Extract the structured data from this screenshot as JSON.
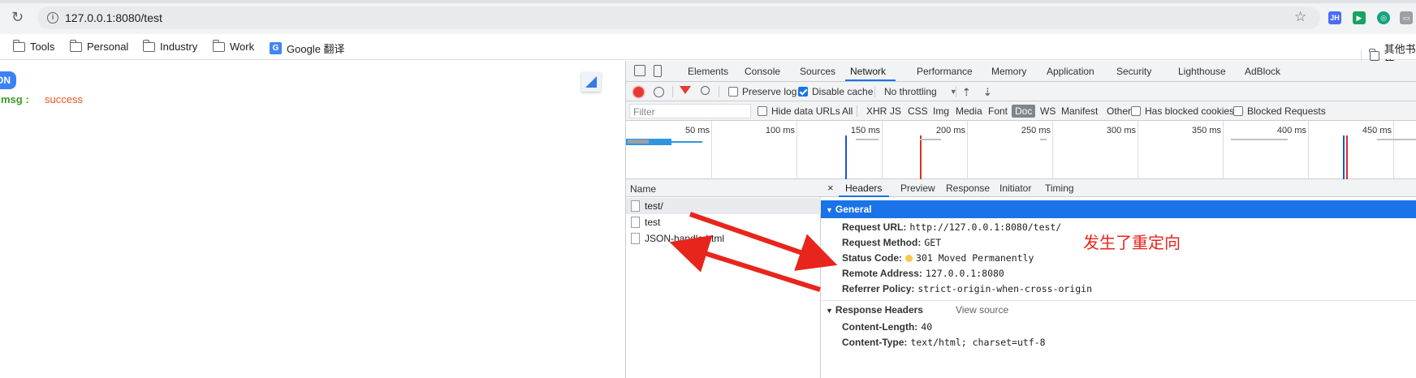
{
  "browser": {
    "url": "127.0.0.1:8080/test",
    "bookmarks": [
      "Tools",
      "Personal",
      "Industry",
      "Work",
      "Google 翻译"
    ],
    "other_bookmarks": "其他书签",
    "extensions": [
      {
        "name": "jh-extension-icon",
        "label": "JH",
        "color": "#4a6cf7"
      },
      {
        "name": "flag-extension-icon",
        "label": "▶",
        "color": "#1aa260"
      },
      {
        "name": "chatgpt-extension-icon",
        "label": "◎",
        "color": "#10a37f"
      },
      {
        "name": "cast-extension-icon",
        "label": "▭",
        "color": "#9aa0a6"
      }
    ]
  },
  "page": {
    "json_label": "ON",
    "msg_key": "msg :",
    "msg_value": "success"
  },
  "devtools": {
    "tabs": [
      "Elements",
      "Console",
      "Sources",
      "Network",
      "Performance",
      "Memory",
      "Application",
      "Security",
      "Lighthouse",
      "AdBlock"
    ],
    "active_tab": "Network",
    "toolbar": {
      "preserve_log": "Preserve log",
      "disable_cache": "Disable cache",
      "throttling": "No throttling"
    },
    "filter": {
      "placeholder": "Filter",
      "hide_data_urls": "Hide data URLs",
      "types": [
        "All",
        "XHR",
        "JS",
        "CSS",
        "Img",
        "Media",
        "Font",
        "Doc",
        "WS",
        "Manifest",
        "Other"
      ],
      "active_type": "Doc",
      "has_blocked_cookies": "Has blocked cookies",
      "blocked_requests": "Blocked Requests"
    },
    "overview_ticks": [
      "50 ms",
      "100 ms",
      "150 ms",
      "200 ms",
      "250 ms",
      "300 ms",
      "350 ms",
      "400 ms",
      "450 ms"
    ],
    "name_header": "Name",
    "requests": [
      "test/",
      "test",
      "JSON-handle.html"
    ],
    "detail_tabs": [
      "Headers",
      "Preview",
      "Response",
      "Initiator",
      "Timing"
    ],
    "general": {
      "title": "General",
      "rows": [
        {
          "k": "Request URL:",
          "v": "http://127.0.0.1:8080/test/"
        },
        {
          "k": "Request Method:",
          "v": "GET"
        },
        {
          "k": "Status Code:",
          "v": "301 Moved Permanently"
        },
        {
          "k": "Remote Address:",
          "v": "127.0.0.1:8080"
        },
        {
          "k": "Referrer Policy:",
          "v": "strict-origin-when-cross-origin"
        }
      ]
    },
    "response_headers": {
      "title": "Response Headers",
      "view_source": "View source",
      "rows": [
        {
          "k": "Content-Length:",
          "v": "40"
        },
        {
          "k": "Content-Type:",
          "v": "text/html; charset=utf-8"
        }
      ]
    }
  },
  "annotation": "发生了重定向",
  "colors": {
    "accent": "#1a73e8",
    "annotation": "#e8251c"
  }
}
